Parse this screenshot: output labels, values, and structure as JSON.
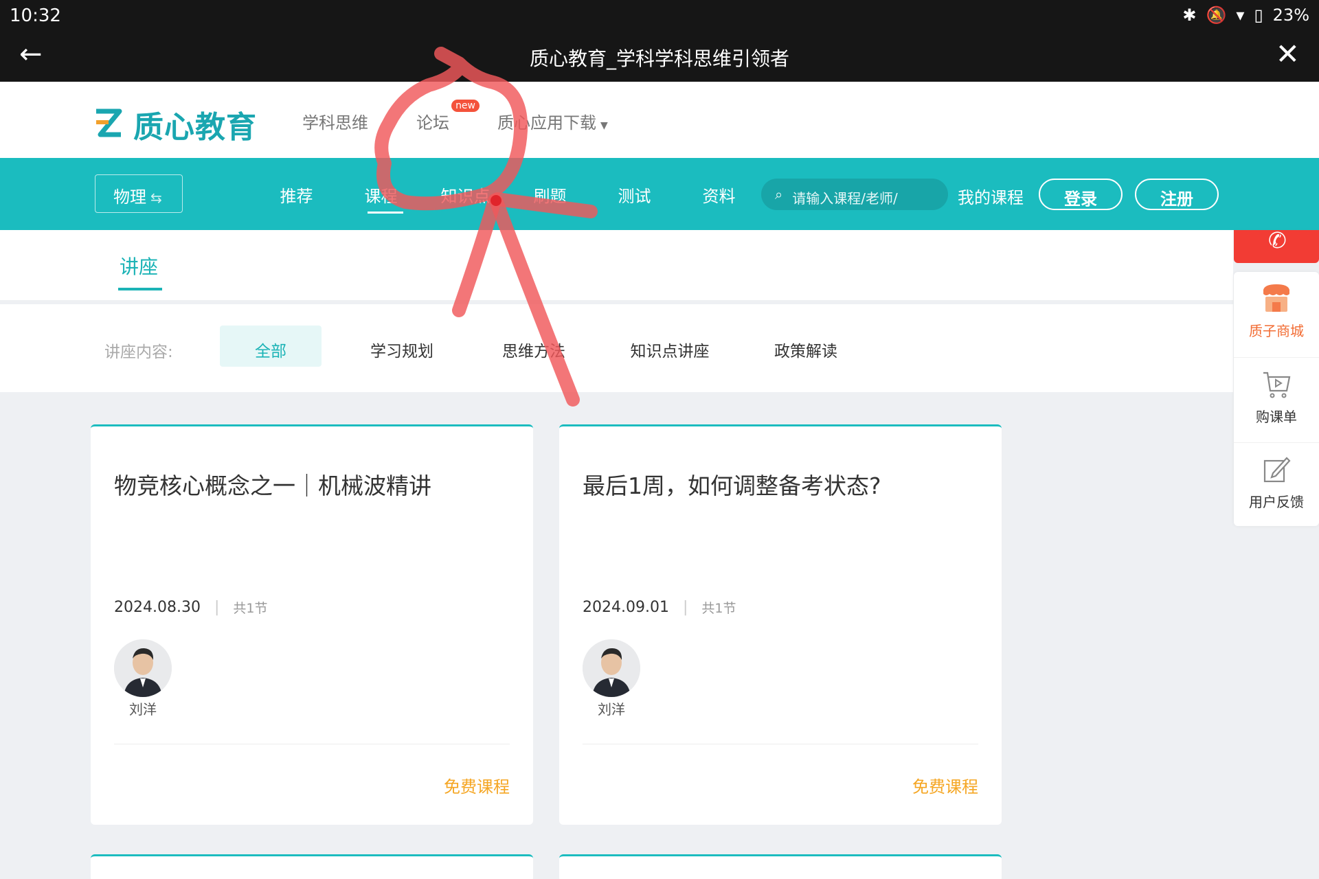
{
  "status": {
    "time": "10:32",
    "battery": "23%"
  },
  "titlebar": {
    "title": "质心教育_学科学科思维引领者",
    "back_icon": "arrow-left-icon",
    "close_icon": "close-icon"
  },
  "header": {
    "brand": "质心教育",
    "nav": [
      {
        "label": "学科思维"
      },
      {
        "label": "论坛",
        "badge": "new"
      },
      {
        "label": "质心应用下载"
      }
    ]
  },
  "navbar": {
    "subject": "物理",
    "items": [
      {
        "label": "推荐"
      },
      {
        "label": "课程",
        "active": true
      },
      {
        "label": "知识点"
      },
      {
        "label": "刷题"
      },
      {
        "label": "测试"
      },
      {
        "label": "资料"
      }
    ],
    "search_placeholder": "请输入课程/老师/",
    "my_courses": "我的课程",
    "login": "登录",
    "register": "注册"
  },
  "tabs": {
    "active": "讲座"
  },
  "filter": {
    "label": "讲座内容:",
    "options": [
      "全部",
      "学习规划",
      "思维方法",
      "知识点讲座",
      "政策解读"
    ],
    "selected": "全部"
  },
  "cards": [
    {
      "title": "物竞核心概念之一｜机械波精讲",
      "date": "2024.08.30",
      "lessons": "共1节",
      "teacher": "刘洋",
      "tag": "免费课程"
    },
    {
      "title": "最后1周，如何调整备考状态?",
      "date": "2024.09.01",
      "lessons": "共1节",
      "teacher": "刘洋",
      "tag": "免费课程"
    }
  ],
  "sidepanel": [
    {
      "label": "质子商城",
      "icon": "shop-icon"
    },
    {
      "label": "购课单",
      "icon": "cart-icon"
    },
    {
      "label": "用户反馈",
      "icon": "feedback-icon"
    }
  ],
  "colors": {
    "brand": "#1bbcbf",
    "free_tag": "#f5a623",
    "annotation": "#f0585a"
  }
}
